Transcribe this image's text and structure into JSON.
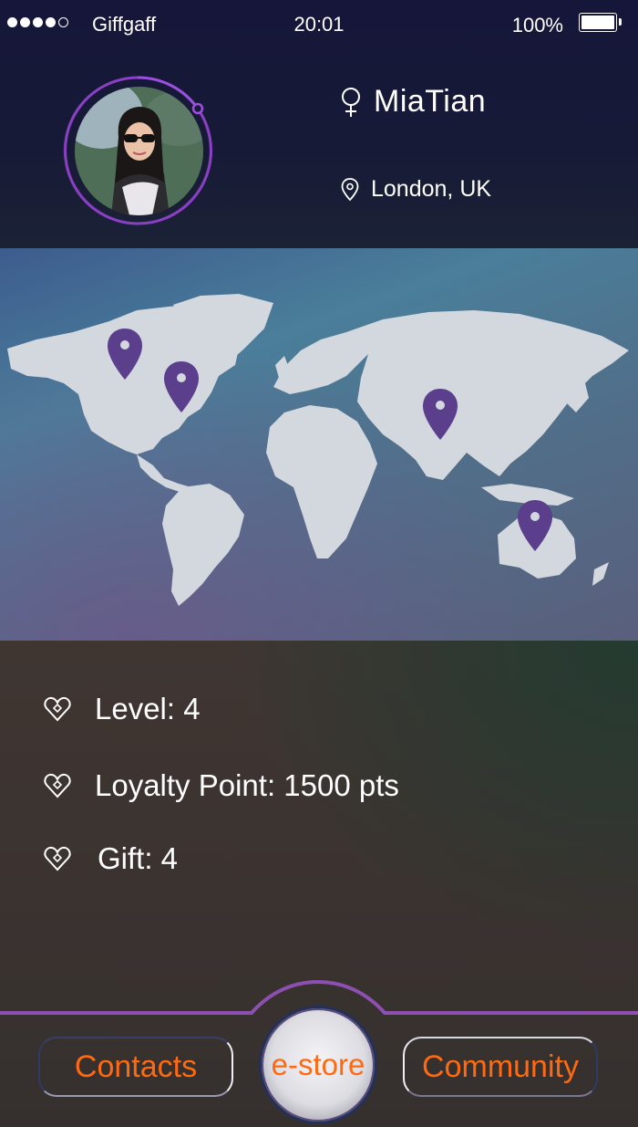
{
  "status_bar": {
    "carrier": "Giffgaff",
    "time": "20:01",
    "battery": "100%",
    "signal_bars_filled": 4,
    "signal_bars_total": 5
  },
  "profile": {
    "name": "MiaTian",
    "location": "London, UK",
    "gender_icon": "female-symbol-icon",
    "location_icon": "location-pin-icon"
  },
  "map": {
    "pin_color": "#5b3e8c",
    "pin_icon": "map-pin-icon"
  },
  "stats": {
    "level": "Level:  4",
    "loyalty": "Loyalty Point: 1500 pts",
    "gift": "Gift: 4",
    "icon": "heart-diamond-icon"
  },
  "nav": {
    "contacts": "Contacts",
    "estore": "e-store",
    "community": "Community",
    "accent": "#ff6a10",
    "line_color": "#8e4fb3"
  }
}
